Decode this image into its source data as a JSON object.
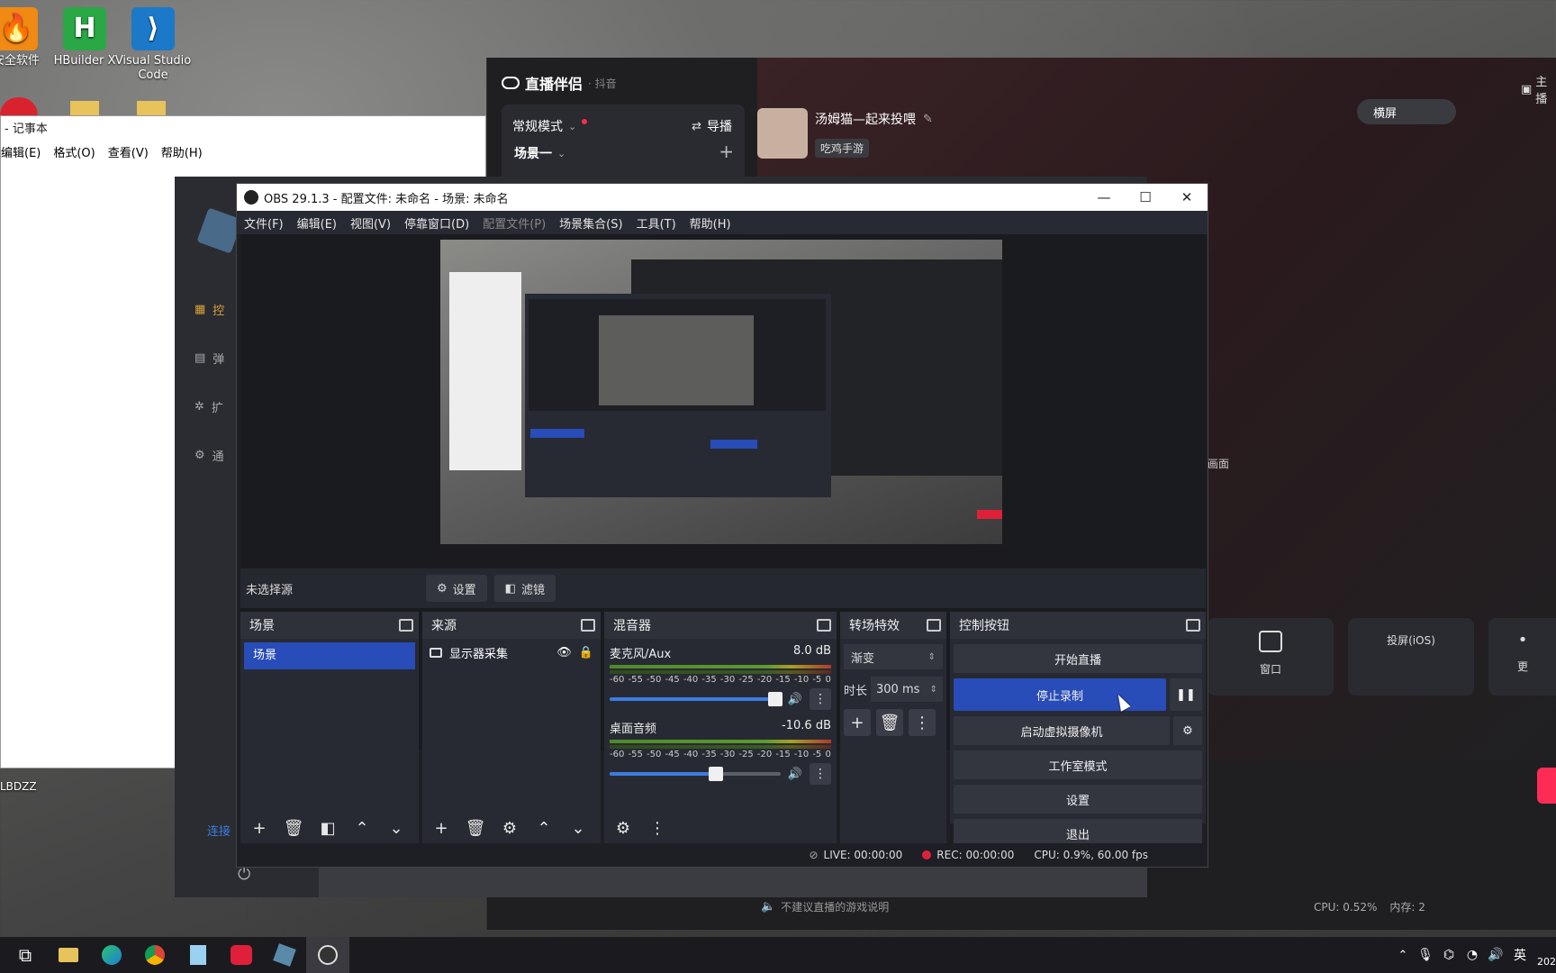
{
  "desktop": {
    "icons": [
      {
        "label": "安全软件",
        "icon": "security-app-icon"
      },
      {
        "label": "HBuilder X",
        "icon": "hbuilder-icon"
      },
      {
        "label": "Visual Studio Code",
        "icon": "vscode-icon"
      }
    ],
    "lbdzz_label": "LBDZZ"
  },
  "notepad": {
    "title": "- 记事本",
    "menu": [
      "编辑(E)",
      "格式(O)",
      "查看(V)",
      "帮助(H)"
    ]
  },
  "douyin": {
    "app_title": "直播伴侣",
    "app_subtitle": "· 抖音",
    "mode_label": "常规模式",
    "guide_label": "导播",
    "scene_label": "场景一",
    "streamer_name": "汤姆猫—起来投喂",
    "category_tag": "吃鸡手游",
    "orientation_btn": "横屏",
    "top_right_label": "主播",
    "screen_label": "画面",
    "tiles": [
      {
        "label": "窗口",
        "icon": "window-icon"
      },
      {
        "label": "投屏(iOS)",
        "icon": "apple-icon"
      },
      {
        "label": "更",
        "icon": "more-icon"
      }
    ],
    "bottom_note": "不建议直播的游戏说明",
    "cpu": "CPU: 0.52%",
    "mem": "内存: 2"
  },
  "launcher": {
    "side_items": [
      "控",
      "弹",
      "扩",
      "通"
    ],
    "link_label": "连接"
  },
  "obs": {
    "title": "OBS 29.1.3 - 配置文件: 未命名 - 场景: 未命名",
    "menu": [
      {
        "label": "文件(F)",
        "enabled": true
      },
      {
        "label": "编辑(E)",
        "enabled": true
      },
      {
        "label": "视图(V)",
        "enabled": true
      },
      {
        "label": "停靠窗口(D)",
        "enabled": true
      },
      {
        "label": "配置文件(P)",
        "enabled": false
      },
      {
        "label": "场景集合(S)",
        "enabled": true
      },
      {
        "label": "工具(T)",
        "enabled": true
      },
      {
        "label": "帮助(H)",
        "enabled": true
      }
    ],
    "no_source": "未选择源",
    "settings_btn": "设置",
    "filters_btn": "滤镜",
    "scenes": {
      "header": "场景",
      "items": [
        "场景"
      ]
    },
    "sources": {
      "header": "来源",
      "items": [
        "显示器采集"
      ]
    },
    "mixer": {
      "header": "混音器",
      "channels": [
        {
          "name": "麦克风/Aux",
          "db": "8.0 dB",
          "level": 0.97
        },
        {
          "name": "桌面音频",
          "db": "-10.6 dB",
          "level": 0.62
        }
      ],
      "scale": [
        "-60",
        "-55",
        "-50",
        "-45",
        "-40",
        "-35",
        "-30",
        "-25",
        "-20",
        "-15",
        "-10",
        "-5",
        "0"
      ]
    },
    "transitions": {
      "header": "转场特效",
      "type": "渐变",
      "duration_label": "时长",
      "duration": "300 ms"
    },
    "controls": {
      "header": "控制按钮",
      "start_stream": "开始直播",
      "stop_record": "停止录制",
      "virtual_cam": "启动虚拟摄像机",
      "studio_mode": "工作室模式",
      "settings": "设置",
      "exit": "退出"
    },
    "status": {
      "live": "LIVE: 00:00:00",
      "rec": "REC: 00:00:00",
      "cpu": "CPU: 0.9%, 60.00 fps"
    }
  },
  "taskbar": {
    "lang": "英",
    "clock_partial": "202"
  },
  "colors": {
    "accent": "#284cb8",
    "record_red": "#e0203a",
    "obs_bg": "#272a33"
  }
}
